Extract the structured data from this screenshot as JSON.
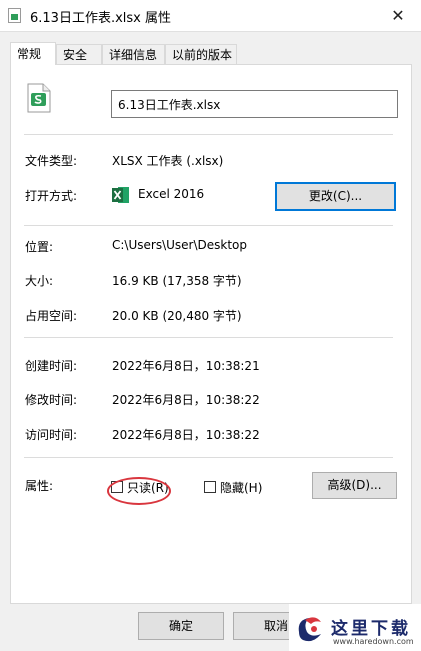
{
  "window": {
    "title": "6.13日工作表.xlsx 属性",
    "close_glyph": "✕"
  },
  "tabs": [
    {
      "label": "常规",
      "active": true
    },
    {
      "label": "安全",
      "active": false
    },
    {
      "label": "详细信息",
      "active": false
    },
    {
      "label": "以前的版本",
      "active": false
    }
  ],
  "general": {
    "file_name": "6.13日工作表.xlsx",
    "file_type": {
      "label": "文件类型:",
      "value": "XLSX 工作表 (.xlsx)"
    },
    "opens_with": {
      "label": "打开方式:",
      "value": "Excel 2016",
      "change_button": "更改(C)..."
    },
    "location": {
      "label": "位置:",
      "value": "C:\\Users\\User\\Desktop"
    },
    "size": {
      "label": "大小:",
      "value": "16.9 KB (17,358 字节)"
    },
    "size_on_disk": {
      "label": "占用空间:",
      "value": "20.0 KB (20,480 字节)"
    },
    "created": {
      "label": "创建时间:",
      "value": "2022年6月8日，10:38:21"
    },
    "modified": {
      "label": "修改时间:",
      "value": "2022年6月8日，10:38:22"
    },
    "accessed": {
      "label": "访问时间:",
      "value": "2022年6月8日，10:38:22"
    },
    "attributes": {
      "label": "属性:",
      "read_only": {
        "label": "只读(R)",
        "checked": false
      },
      "hidden": {
        "label": "隐藏(H)",
        "checked": false
      },
      "advanced_button": "高级(D)..."
    }
  },
  "footer": {
    "ok": "确定",
    "cancel": "取消"
  },
  "watermark": {
    "main": "这里下载",
    "url": "www.haredown.com"
  },
  "colors": {
    "accent": "#0078d7",
    "highlight_ring": "#d9363e",
    "excel_green": "#1d6f42"
  }
}
